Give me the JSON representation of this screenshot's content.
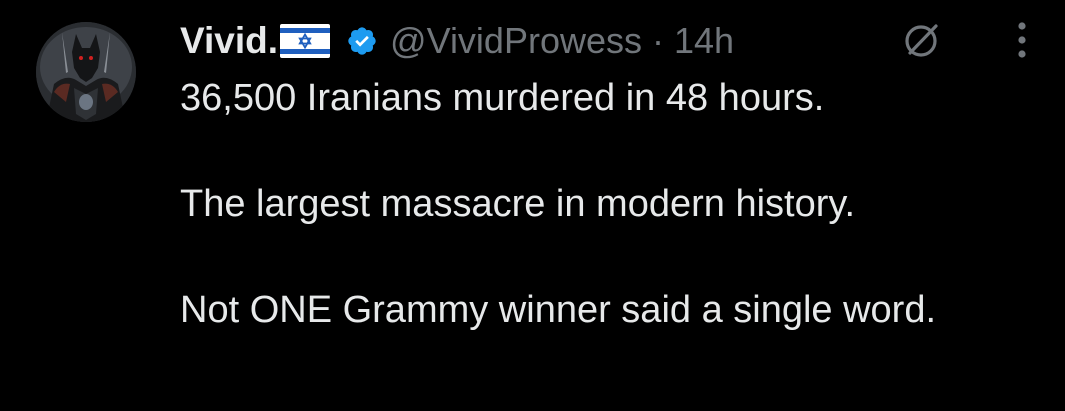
{
  "author": {
    "display_name": "Vivid.",
    "handle": "@VividProwess",
    "separator": "·",
    "timestamp": "14h",
    "flag_icon": "israel-flag-icon",
    "verified_icon": "verified-badge-icon",
    "verified_color": "#1d9bf0"
  },
  "actions": {
    "grok_icon": "grok-icon",
    "more_icon": "more-options-icon"
  },
  "tweet": {
    "line1": "36,500 Iranians murdered in 48 hours.",
    "line2": "The largest massacre in modern history.",
    "line3": "Not ONE Grammy winner said a single word."
  },
  "colors": {
    "background": "#000000",
    "primary_text": "#e7e9ea",
    "secondary_text": "#71767b"
  }
}
